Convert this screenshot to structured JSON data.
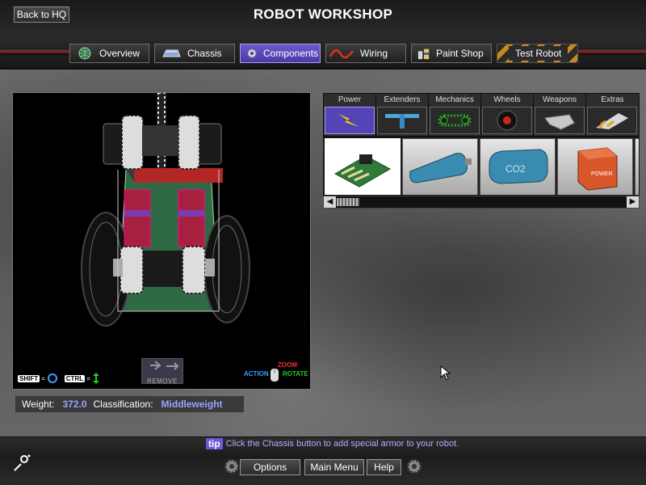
{
  "header": {
    "title": "ROBOT WORKSHOP",
    "back_label": "Back to HQ",
    "tabs": [
      {
        "label": "Overview",
        "icon": "globe-icon"
      },
      {
        "label": "Chassis",
        "icon": "chassis-icon"
      },
      {
        "label": "Components",
        "icon": "gear-icon",
        "active": true
      },
      {
        "label": "Wiring",
        "icon": "wire-icon"
      },
      {
        "label": "Paint Shop",
        "icon": "paint-cans-icon"
      },
      {
        "label": "Test Robot",
        "icon": "hazard-stripes"
      }
    ]
  },
  "viewport": {
    "remove_label": "REMOVE",
    "shift_key": "SHIFT",
    "ctrl_key": "CTRL",
    "equals": "=",
    "action_label": "ACTION",
    "zoom_label": "ZOOM",
    "rotate_label": "ROTATE"
  },
  "stats": {
    "weight_label": "Weight:",
    "weight_value": "372.0",
    "class_label": "Classification:",
    "class_value": "Middleweight"
  },
  "categories": [
    {
      "label": "Power",
      "icon": "lightning-icon",
      "active": true
    },
    {
      "label": "Extenders",
      "icon": "extender-icon"
    },
    {
      "label": "Mechanics",
      "icon": "chain-icon"
    },
    {
      "label": "Wheels",
      "icon": "wheel-icon"
    },
    {
      "label": "Weapons",
      "icon": "blade-icon"
    },
    {
      "label": "Extras",
      "icon": "hazard-wedge-icon"
    }
  ],
  "parts": [
    {
      "name": "circuit-board",
      "selected": true
    },
    {
      "name": "nitrogen-tank"
    },
    {
      "name": "co2-tank",
      "text": "CO2"
    },
    {
      "name": "power-battery",
      "text": "POWER"
    }
  ],
  "tip": {
    "tag": "tip",
    "text": "Click the Chassis button to add special armor to your robot."
  },
  "footer": {
    "options": "Options",
    "main_menu": "Main Menu",
    "help": "Help"
  },
  "colors": {
    "accent": "#6b57d8",
    "stat_value": "#9aa2ff",
    "tip_text": "#b7a9ff"
  }
}
